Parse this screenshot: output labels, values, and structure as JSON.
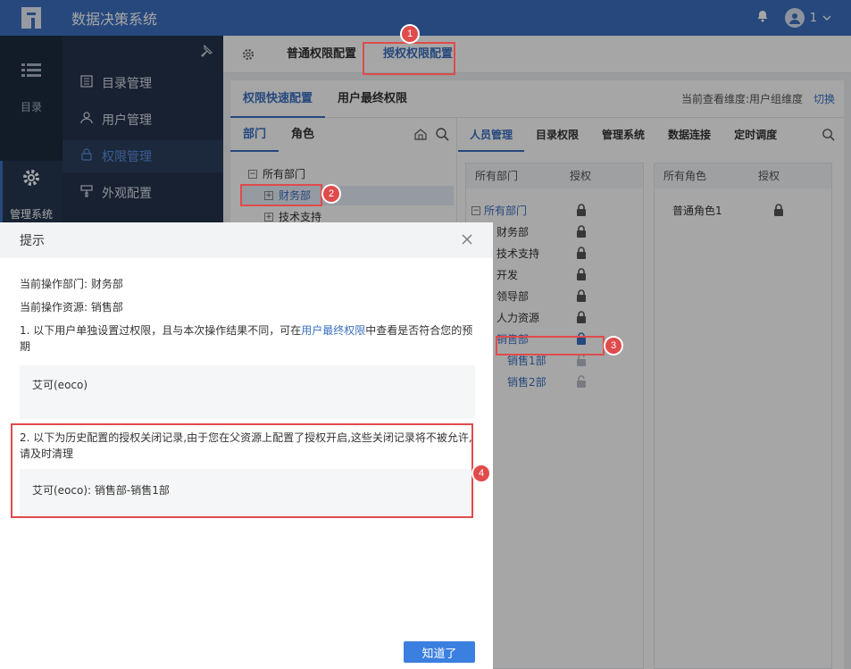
{
  "app": {
    "title": "数据决策系统",
    "user": "1"
  },
  "rail": {
    "items": [
      {
        "label": "目录"
      },
      {
        "label": "管理系统"
      }
    ]
  },
  "sidebar": {
    "items": [
      {
        "label": "目录管理",
        "icon": "catalog-icon"
      },
      {
        "label": "用户管理",
        "icon": "user-icon"
      },
      {
        "label": "权限管理",
        "icon": "lock-icon"
      },
      {
        "label": "外观配置",
        "icon": "paint-icon"
      }
    ]
  },
  "main": {
    "tabs": [
      {
        "label": "普通权限配置"
      },
      {
        "label": "授权权限配置"
      }
    ],
    "subtabs": [
      {
        "label": "权限快速配置"
      },
      {
        "label": "用户最终权限"
      }
    ],
    "dimension_text": "当前查看维度:用户组维度",
    "switch_label": "切换",
    "left_tabs": [
      {
        "label": "部门"
      },
      {
        "label": "角色"
      }
    ],
    "tree": [
      {
        "label": "所有部门"
      },
      {
        "label": "财务部"
      },
      {
        "label": "技术支持"
      }
    ],
    "perm_tabs": [
      {
        "label": "人员管理"
      },
      {
        "label": "目录权限"
      },
      {
        "label": "管理系统"
      },
      {
        "label": "数据连接"
      },
      {
        "label": "定时调度"
      }
    ],
    "grid_dept": {
      "header_name": "所有部门",
      "header_auth": "授权",
      "rows": [
        "所有部门",
        "财务部",
        "技术支持",
        "开发",
        "领导部",
        "人力资源",
        "销售部",
        "销售1部",
        "销售2部"
      ]
    },
    "grid_role": {
      "header_name": "所有角色",
      "header_auth": "授权",
      "rows": [
        "普通角色1"
      ]
    }
  },
  "dialog": {
    "title": "提示",
    "line1": "当前操作部门: 财务部",
    "line2": "当前操作资源: 销售部",
    "line3_pre": "1. 以下用户单独设置过权限，且与本次操作结果不同，可在",
    "line3_link": "用户最终权限",
    "line3_post": "中查看是否符合您的预期",
    "box1": "艾可(eoco)",
    "line4": "2. 以下为历史配置的授权关闭记录,由于您在父资源上配置了授权开启,这些关闭记录将不被允许,请及时清理",
    "box2": "艾可(eoco): 销售部-销售1部",
    "ok_label": "知道了"
  },
  "badges": [
    "1",
    "2",
    "3",
    "4"
  ],
  "colors": {
    "topbar": "#3b6fc0",
    "accent": "#3b6fc0",
    "highlight": "#e04b4b",
    "button": "#3b7fe0"
  }
}
